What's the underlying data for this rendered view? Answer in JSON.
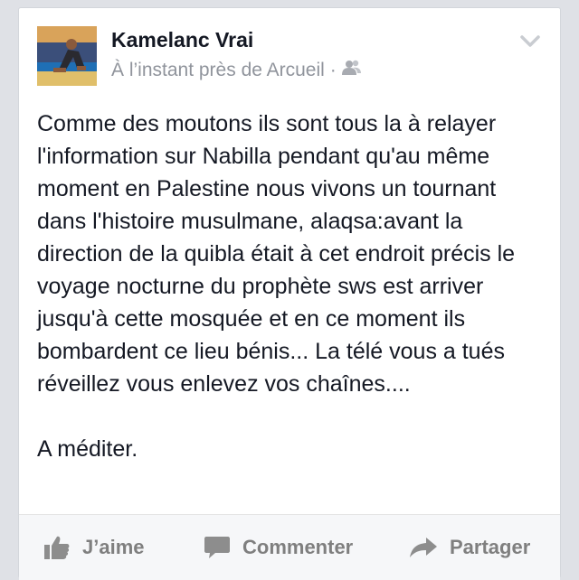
{
  "post": {
    "author": "Kamelanc Vrai",
    "meta": "À l’instant près de Arcueil",
    "meta_separator": "·",
    "body": "Comme des moutons ils sont tous la à relayer l'information sur Nabilla pendant qu'au même moment en Palestine nous vivons un tournant dans l'histoire musulmane, alaqsa:avant la direction de la quibla était à cet endroit précis le voyage nocturne du prophète sws est arriver jusqu'à cette mosquée et en ce moment ils bombardent ce lieu bénis... La télé vous a tués réveillez vous enlevez vos chaînes....\n\nA méditer."
  },
  "actions": {
    "like_label": "J’aime",
    "comment_label": "Commenter",
    "share_label": "Partager"
  },
  "icons": {
    "privacy": "friends-icon",
    "menu": "chevron-down-icon",
    "like": "thumbs-up-icon",
    "comment": "comment-bubble-icon",
    "share": "share-arrow-icon"
  },
  "colors": {
    "background": "#dfe1e6",
    "card": "#ffffff",
    "author_text": "#141823",
    "meta_text": "#90949c",
    "action_text": "#7f7f7f",
    "footer": "#f6f7f9"
  }
}
